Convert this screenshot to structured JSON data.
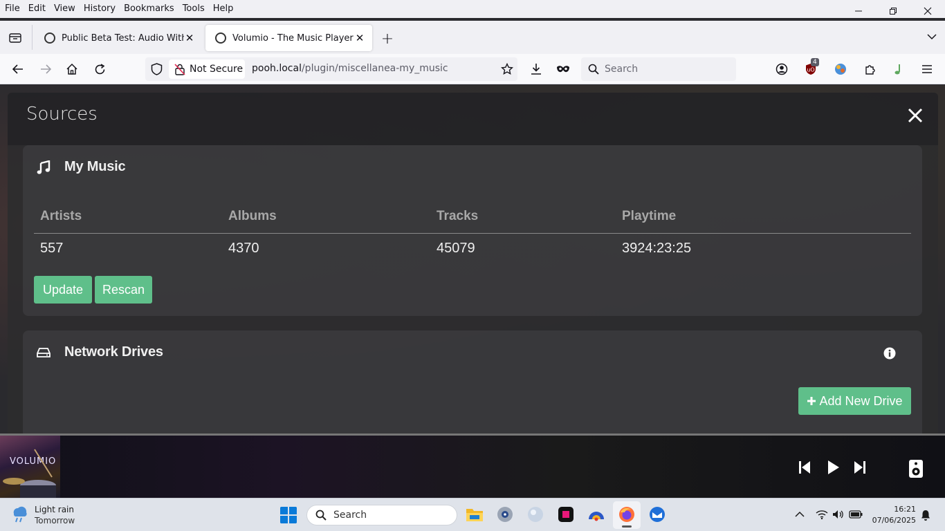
{
  "browser": {
    "menu": [
      "File",
      "Edit",
      "View",
      "History",
      "Bookmarks",
      "Tools",
      "Help"
    ],
    "tabs": [
      {
        "title": "Public Beta Test: Audio Without",
        "active": false
      },
      {
        "title": "Volumio - The Music Player",
        "active": true
      }
    ],
    "security_label": "Not Secure",
    "url_host": "pooh.local",
    "url_path": "/plugin/miscellanea-my_music",
    "search_placeholder": "Search",
    "ublock_badge": "4"
  },
  "modal": {
    "title": "Sources",
    "my_music": {
      "title": "My Music",
      "headers": [
        "Artists",
        "Albums",
        "Tracks",
        "Playtime"
      ],
      "values": [
        "557",
        "4370",
        "45079",
        "3924:23:25"
      ],
      "update_label": "Update",
      "rescan_label": "Rescan"
    },
    "network_drives": {
      "title": "Network Drives",
      "add_label": "Add New Drive"
    }
  },
  "player": {
    "album_logo": "VOLUMIO"
  },
  "taskbar": {
    "weather_title": "Light rain",
    "weather_sub": "Tomorrow",
    "search_placeholder": "Search",
    "time": "16:21",
    "date": "07/06/2025"
  },
  "colors": {
    "accent_green": "#5fbf8a",
    "ublock_red": "#800000"
  }
}
